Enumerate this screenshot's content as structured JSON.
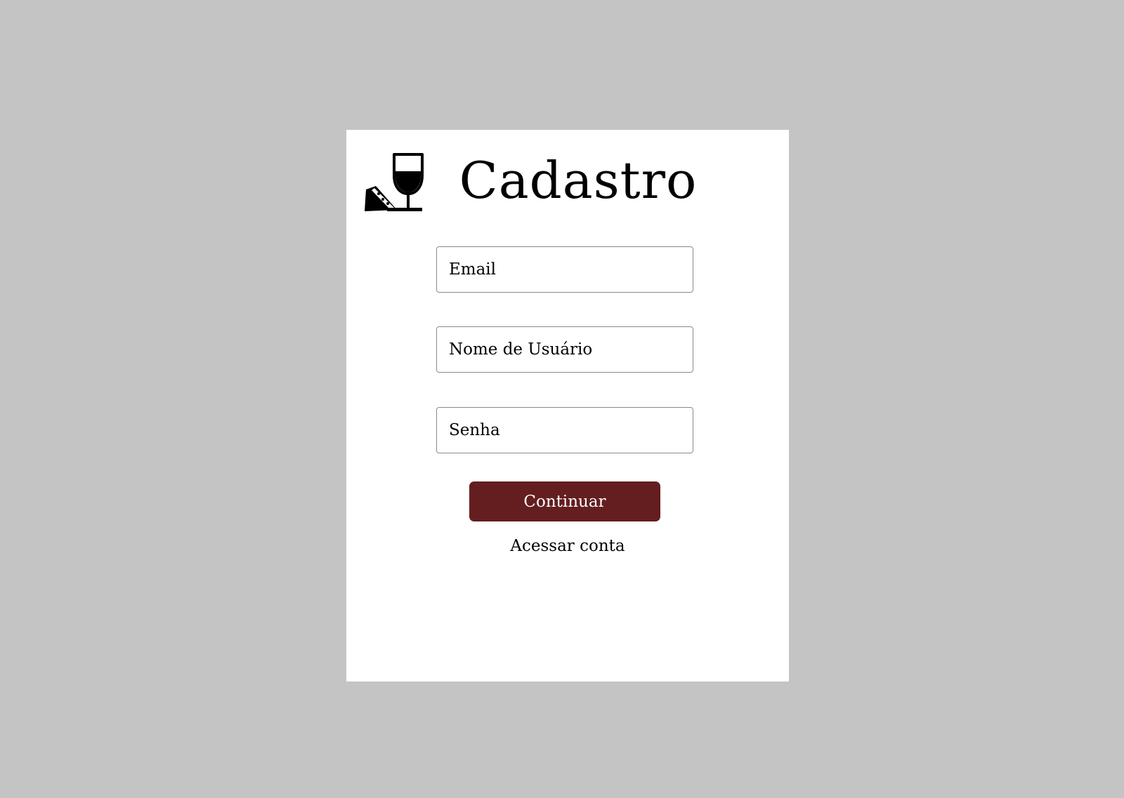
{
  "page": {
    "title": "Cadastro",
    "logo_icon": "cheese-and-wine-glass-icon"
  },
  "form": {
    "email_placeholder": "Email",
    "username_placeholder": "Nome de Usuário",
    "password_placeholder": "Senha",
    "submit_label": "Continuar",
    "login_link": "Acessar conta"
  },
  "colors": {
    "background": "#c4c4c4",
    "card": "#ffffff",
    "accent": "#641e20",
    "input_border": "#8a8a8a",
    "text": "#000000"
  }
}
